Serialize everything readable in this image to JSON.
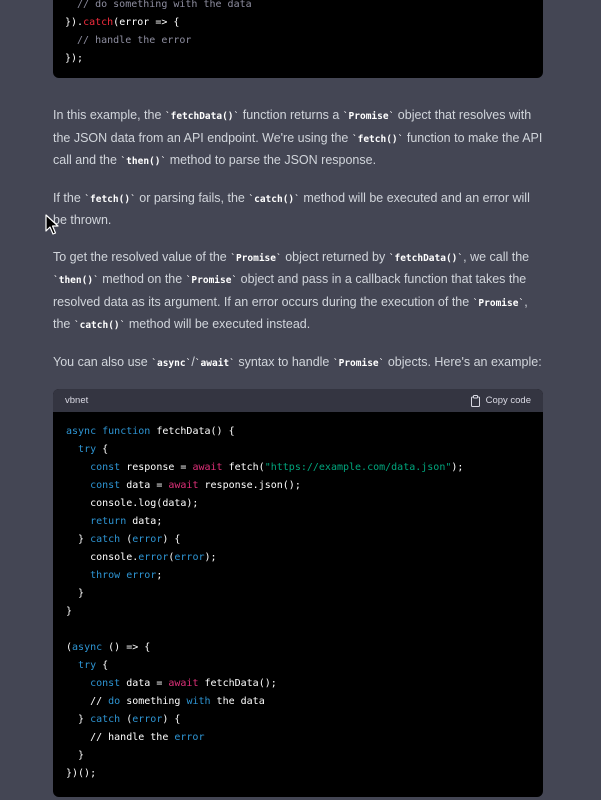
{
  "top_code": {
    "lines": [
      [
        {
          "t": "  // do something with the data",
          "c": "c-comment"
        }
      ],
      [
        {
          "t": "}).",
          "c": "c-plain"
        },
        {
          "t": "catch",
          "c": "c-fn"
        },
        {
          "t": "(error => {",
          "c": "c-plain"
        }
      ],
      [
        {
          "t": "  // handle the error",
          "c": "c-comment"
        }
      ],
      [
        {
          "t": "});",
          "c": "c-plain"
        }
      ]
    ]
  },
  "paragraphs": [
    [
      {
        "t": "In this example, the "
      },
      {
        "code": "fetchData()"
      },
      {
        "t": " function returns a "
      },
      {
        "code": "Promise"
      },
      {
        "t": " object that resolves with the JSON data from an API endpoint. We're using the "
      },
      {
        "code": "fetch()"
      },
      {
        "t": " function to make the API call and the "
      },
      {
        "code": "then()"
      },
      {
        "t": " method to parse the JSON response."
      }
    ],
    [
      {
        "t": "If the "
      },
      {
        "code": "fetch()"
      },
      {
        "t": " or parsing fails, the "
      },
      {
        "code": "catch()"
      },
      {
        "t": " method will be executed and an error will be thrown."
      }
    ],
    [
      {
        "t": "To get the resolved value of the "
      },
      {
        "code": "Promise"
      },
      {
        "t": " object returned by "
      },
      {
        "code": "fetchData()"
      },
      {
        "t": ", we call the "
      },
      {
        "code": "then()"
      },
      {
        "t": " method on the "
      },
      {
        "code": "Promise"
      },
      {
        "t": " object and pass in a callback function that takes the resolved data as its argument. If an error occurs during the execution of the "
      },
      {
        "code": "Promise"
      },
      {
        "t": ", the "
      },
      {
        "code": "catch()"
      },
      {
        "t": " method will be executed instead."
      }
    ],
    [
      {
        "t": "You can also use "
      },
      {
        "code": "async"
      },
      {
        "t": "/"
      },
      {
        "code": "await"
      },
      {
        "t": " syntax to handle "
      },
      {
        "code": "Promise"
      },
      {
        "t": " objects. Here's an example:"
      }
    ]
  ],
  "code_block": {
    "language": "vbnet",
    "copy_label": "Copy code",
    "copy_icon": "clipboard-icon",
    "lines": [
      [
        {
          "t": "async",
          "c": "c-kw"
        },
        {
          "t": " ",
          "c": "c-plain"
        },
        {
          "t": "function",
          "c": "c-kw"
        },
        {
          "t": " fetchData() {",
          "c": "c-plain"
        }
      ],
      [
        {
          "t": "  ",
          "c": "c-plain"
        },
        {
          "t": "try",
          "c": "c-kw"
        },
        {
          "t": " {",
          "c": "c-plain"
        }
      ],
      [
        {
          "t": "    ",
          "c": "c-plain"
        },
        {
          "t": "const",
          "c": "c-kw"
        },
        {
          "t": " response = ",
          "c": "c-plain"
        },
        {
          "t": "await",
          "c": "c-await"
        },
        {
          "t": " fetch(",
          "c": "c-plain"
        },
        {
          "t": "\"https://example.com/data.json\"",
          "c": "c-str"
        },
        {
          "t": ");",
          "c": "c-plain"
        }
      ],
      [
        {
          "t": "    ",
          "c": "c-plain"
        },
        {
          "t": "const",
          "c": "c-kw"
        },
        {
          "t": " data = ",
          "c": "c-plain"
        },
        {
          "t": "await",
          "c": "c-await"
        },
        {
          "t": " response.json();",
          "c": "c-plain"
        }
      ],
      [
        {
          "t": "    console.log(data);",
          "c": "c-plain"
        }
      ],
      [
        {
          "t": "    ",
          "c": "c-plain"
        },
        {
          "t": "return",
          "c": "c-kw"
        },
        {
          "t": " data;",
          "c": "c-plain"
        }
      ],
      [
        {
          "t": "  } ",
          "c": "c-plain"
        },
        {
          "t": "catch",
          "c": "c-kw"
        },
        {
          "t": " (",
          "c": "c-plain"
        },
        {
          "t": "error",
          "c": "c-kw"
        },
        {
          "t": ") {",
          "c": "c-plain"
        }
      ],
      [
        {
          "t": "    console.",
          "c": "c-plain"
        },
        {
          "t": "error",
          "c": "c-kw"
        },
        {
          "t": "(",
          "c": "c-plain"
        },
        {
          "t": "error",
          "c": "c-kw"
        },
        {
          "t": ");",
          "c": "c-plain"
        }
      ],
      [
        {
          "t": "    ",
          "c": "c-plain"
        },
        {
          "t": "throw",
          "c": "c-kw"
        },
        {
          "t": " ",
          "c": "c-plain"
        },
        {
          "t": "error",
          "c": "c-kw"
        },
        {
          "t": ";",
          "c": "c-plain"
        }
      ],
      [
        {
          "t": "  }",
          "c": "c-plain"
        }
      ],
      [
        {
          "t": "}",
          "c": "c-plain"
        }
      ],
      [
        {
          "t": "",
          "c": "c-plain"
        }
      ],
      [
        {
          "t": "(",
          "c": "c-plain"
        },
        {
          "t": "async",
          "c": "c-kw"
        },
        {
          "t": " () => {",
          "c": "c-plain"
        }
      ],
      [
        {
          "t": "  ",
          "c": "c-plain"
        },
        {
          "t": "try",
          "c": "c-kw"
        },
        {
          "t": " {",
          "c": "c-plain"
        }
      ],
      [
        {
          "t": "    ",
          "c": "c-plain"
        },
        {
          "t": "const",
          "c": "c-kw"
        },
        {
          "t": " data = ",
          "c": "c-plain"
        },
        {
          "t": "await",
          "c": "c-await"
        },
        {
          "t": " fetchData();",
          "c": "c-plain"
        }
      ],
      [
        {
          "t": "    // ",
          "c": "c-plain"
        },
        {
          "t": "do",
          "c": "c-kw"
        },
        {
          "t": " something ",
          "c": "c-plain"
        },
        {
          "t": "with",
          "c": "c-kw"
        },
        {
          "t": " the data",
          "c": "c-plain"
        }
      ],
      [
        {
          "t": "  } ",
          "c": "c-plain"
        },
        {
          "t": "catch",
          "c": "c-kw"
        },
        {
          "t": " (",
          "c": "c-plain"
        },
        {
          "t": "error",
          "c": "c-kw"
        },
        {
          "t": ") {",
          "c": "c-plain"
        }
      ],
      [
        {
          "t": "    // handle the ",
          "c": "c-plain"
        },
        {
          "t": "error",
          "c": "c-kw"
        }
      ],
      [
        {
          "t": "  }",
          "c": "c-plain"
        }
      ],
      [
        {
          "t": "})();",
          "c": "c-plain"
        }
      ]
    ]
  },
  "colors": {
    "background": "#444654",
    "code_background": "#000000",
    "code_header": "#343541",
    "text": "#d1d5db"
  }
}
